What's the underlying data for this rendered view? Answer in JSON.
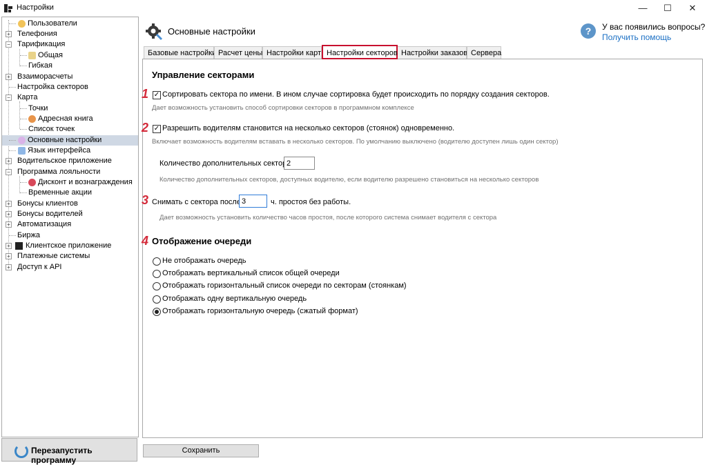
{
  "window": {
    "title": "Настройки",
    "minimize_glyph": "—",
    "maximize_glyph": "☐",
    "close_glyph": "✕"
  },
  "tree": {
    "items": [
      {
        "label": "Пользователи",
        "icon": "users-icon"
      },
      {
        "label": "Телефония"
      },
      {
        "label": "Тарификация"
      },
      {
        "label": "Общая",
        "icon": "tariff-icon"
      },
      {
        "label": "Гибкая"
      },
      {
        "label": "Взаиморасчеты"
      },
      {
        "label": "Настройка секторов"
      },
      {
        "label": "Карта"
      },
      {
        "label": "Точки"
      },
      {
        "label": "Адресная книга",
        "icon": "address-book-icon"
      },
      {
        "label": "Список точек"
      },
      {
        "label": "Основные настройки",
        "icon": "settings-icon"
      },
      {
        "label": "Язык интерфейса",
        "icon": "language-icon"
      },
      {
        "label": "Водительское приложение"
      },
      {
        "label": "Программа лояльности"
      },
      {
        "label": "Дисконт и вознаграждения",
        "icon": "discount-icon"
      },
      {
        "label": "Временные акции"
      },
      {
        "label": "Бонусы клиентов"
      },
      {
        "label": "Бонусы водителей"
      },
      {
        "label": "Автоматизация"
      },
      {
        "label": "Биржа"
      },
      {
        "label": "Клиентское приложение",
        "icon": "qr-icon"
      },
      {
        "label": "Платежные системы"
      },
      {
        "label": "Доступ к API"
      }
    ]
  },
  "restart_button": {
    "label": "Перезапустить программу"
  },
  "header": {
    "title": "Основные настройки",
    "help_question": "У вас появились вопросы?",
    "help_link": "Получить помощь"
  },
  "tabs": [
    {
      "label": "Базовые настройки"
    },
    {
      "label": "Расчет цены"
    },
    {
      "label": "Настройки карт"
    },
    {
      "label": "Настройки секторов",
      "active": true
    },
    {
      "label": "Настройки заказов"
    },
    {
      "label": "Сервера"
    }
  ],
  "sectors": {
    "title": "Управление секторами",
    "sort_by_name": {
      "marker": "1",
      "checked": true,
      "label": "Сортировать сектора по имени. В ином случае сортировка будет происходить по порядку создания секторов.",
      "hint": "Дает возможность установить способ сортировки секторов в программном комплексе"
    },
    "multi_sector": {
      "marker": "2",
      "checked": true,
      "label": "Разрешить водителям становится на несколько секторов (стоянок) одновременно.",
      "hint": "Включает возможность водителям вставать в несколько секторов. По умолчанию выключено (водителю доступен лишь один сектор)"
    },
    "extra_sectors": {
      "label": "Количество дополнительных секторов",
      "value": "2",
      "hint": "Количество дополнительных секторов, доступных водителю, если водителю разрешено становиться на несколько секторов"
    },
    "remove_after": {
      "marker": "3",
      "label_before": "Снимать с сектора после",
      "value": "3",
      "label_after": "ч. простоя без работы.",
      "hint": "Дает возможность установить количество часов простоя, после которого система снимает водителя с сектора"
    }
  },
  "queue": {
    "marker": "4",
    "title": "Отображение очереди",
    "options": [
      {
        "label": "Не отображать очередь",
        "selected": false
      },
      {
        "label": "Отображать вертикальный список общей очереди",
        "selected": false
      },
      {
        "label": "Отображать горизонтальный список очереди по секторам (стоянкам)",
        "selected": false
      },
      {
        "label": "Отображать одну вертикальную очередь",
        "selected": false
      },
      {
        "label": "Отображать горизонтальную очередь (сжатый формат)",
        "selected": true
      }
    ]
  },
  "save_button": {
    "label": "Сохранить"
  },
  "colors": {
    "accent_red": "#c8102e",
    "link_blue": "#1a6fc4",
    "help_blue": "#5d95c9"
  }
}
